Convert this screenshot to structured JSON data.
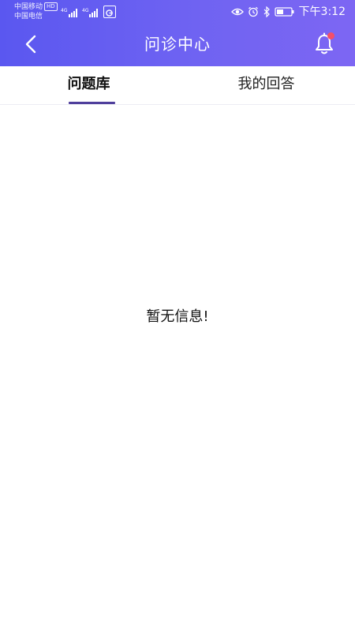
{
  "status_bar": {
    "carrier_1": "中国移动",
    "carrier_1_badge": "HD",
    "carrier_2": "中国电信",
    "network_1": "4G",
    "network_2": "4G",
    "time": "下午3:12",
    "icons": [
      "eye-icon",
      "alarm-icon",
      "bluetooth-icon",
      "battery-icon"
    ]
  },
  "navbar": {
    "title": "问诊中心",
    "back_icon": "chevron-left-icon",
    "bell_icon": "bell-icon",
    "badge_color": "#f24f69"
  },
  "tabs": [
    {
      "label": "问题库",
      "active": true
    },
    {
      "label": "我的回答",
      "active": false
    }
  ],
  "empty_state": {
    "message": "暂无信息!"
  },
  "colors": {
    "header_gradient_start": "#5a57f0",
    "header_gradient_end": "#7d66f3",
    "tab_indicator": "#4f3f9c"
  }
}
